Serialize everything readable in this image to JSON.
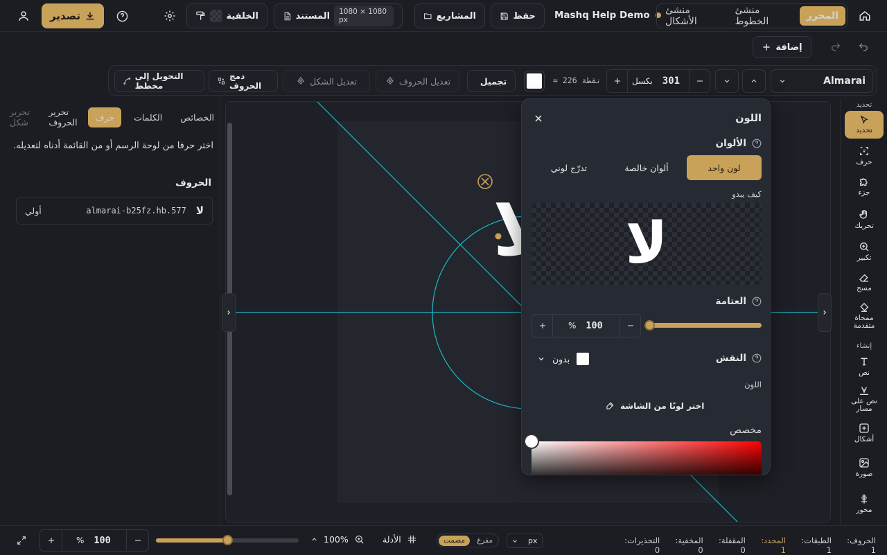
{
  "topbar": {
    "home_tabs": [
      "المحرر",
      "منشئ الخطوط",
      "منشئ الأشكال"
    ],
    "project_name": "Mashq Help Demo",
    "save_label": "حفظ",
    "projects_label": "المشاريع",
    "document_label": "المستند",
    "document_size": "1080 × 1080 px",
    "background_label": "الخلفية",
    "export_label": "تصدير"
  },
  "bar2": {
    "add_label": "إضافة"
  },
  "toolbar": {
    "font_name": "Almarai",
    "size_value": "301",
    "size_unit": "بكسل",
    "points": "≈ 226 نقطة",
    "beautify_label": "تجميل",
    "edit_letters_label": "تعديل الحروف",
    "edit_shape_label": "تعديل الشكل",
    "merge_letters_label": "دمج الحروف",
    "to_outline_label": "التحويل إلى مخطط"
  },
  "left_panel": {
    "tabs": [
      "الخصائص",
      "الكلمات",
      "حرف",
      "تحرير الحروف",
      "تحرير شكل"
    ],
    "active_tab": "حرف",
    "hint": "اختر حرفا من لوحة الرسم أو من القائمة أدناه لتعديله.",
    "letters_heading": "الحروف",
    "letter_item": {
      "glyph": "لا",
      "id": "almarai-b25fz.hb.577",
      "tag": "أولي"
    }
  },
  "canvas": {
    "glyph": "لا"
  },
  "color_panel": {
    "title": "اللون",
    "colors_label": "الألوان",
    "modes": [
      "لون واحد",
      "ألوان خالصة",
      "تدرّج لوني"
    ],
    "active_mode": "لون واحد",
    "preview_label": "كيف يبدو",
    "preview_glyph": "لا",
    "opacity_label": "العتامة",
    "opacity_value": "100",
    "opacity_unit": "%",
    "opacity_level": 1.0,
    "stroke_label": "النقش",
    "stroke_value": "بدون",
    "stroke_color_label": "اللون",
    "eyedropper_label": "اختر لونًا من الشاشة",
    "custom_label": "مخصص",
    "hue_color": "#ff0000"
  },
  "right_rail": {
    "group1": "تحديد",
    "items": [
      "تحديد",
      "حرف",
      "جزء",
      "تحريك",
      "تكبير",
      "مسح",
      "ممحاة متقدمة"
    ],
    "group2": "إنشاء",
    "items2": [
      "نص",
      "نص على مسار",
      "أشكال",
      "صورة",
      "محور"
    ]
  },
  "statusbar": {
    "zoom_value": "100",
    "zoom_unit": "%",
    "zoom_percent": "100%",
    "zoom_level": 0.5,
    "guides_label": "الأدلة",
    "mode_filled": "مفرغ",
    "mode_solid": "مصمت",
    "unit": "px",
    "stats": [
      "الحروف: 1",
      "الطبقات: 1",
      "المحدد: 1",
      "المقفلة: 0",
      "المخفية: 0",
      "التحذيرات: 0"
    ]
  },
  "colors": {
    "accent": "#c9a25a",
    "guide": "#1fb8c9",
    "bg": "#1b1d23"
  }
}
